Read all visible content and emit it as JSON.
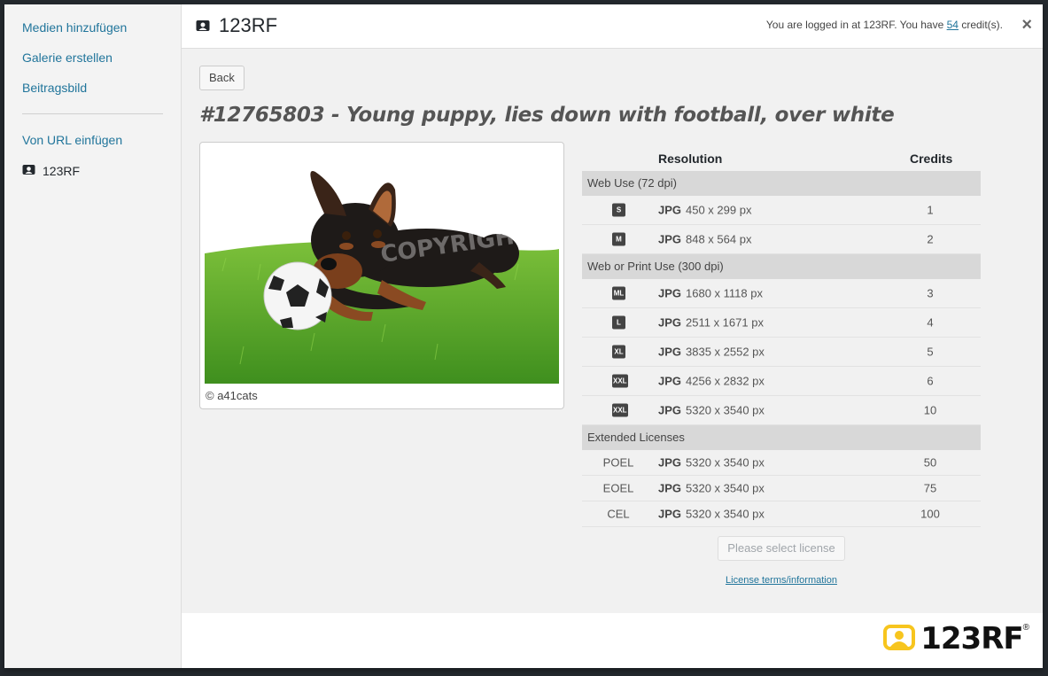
{
  "sidebar": {
    "items": [
      {
        "label": "Medien hinzufügen"
      },
      {
        "label": "Galerie erstellen"
      },
      {
        "label": "Beitragsbild"
      },
      {
        "label": "Von URL einfügen"
      },
      {
        "label": "123RF"
      }
    ]
  },
  "header": {
    "title": "123RF",
    "login_prefix": "You are logged in at 123RF. You have ",
    "credits": "54",
    "login_suffix": " credit(s).",
    "close_label": "×"
  },
  "main": {
    "back_label": "Back",
    "image_title": "#12765803 - Young puppy, lies down with football, over white",
    "image_credit": "© a41cats",
    "watermark": "COPYRIGHT"
  },
  "table": {
    "col_resolution": "Resolution",
    "col_credits": "Credits",
    "groups": [
      {
        "label": "Web Use (72 dpi)"
      },
      {
        "label": "Web or Print Use (300 dpi)"
      },
      {
        "label": "Extended Licenses"
      }
    ],
    "web": [
      {
        "size": "S",
        "format": "JPG",
        "resolution": "450 x 299 px",
        "credits": "1"
      },
      {
        "size": "M",
        "format": "JPG",
        "resolution": "848 x 564 px",
        "credits": "2"
      }
    ],
    "print": [
      {
        "size": "ML",
        "format": "JPG",
        "resolution": "1680 x 1118 px",
        "credits": "3"
      },
      {
        "size": "L",
        "format": "JPG",
        "resolution": "2511 x 1671 px",
        "credits": "4"
      },
      {
        "size": "XL",
        "format": "JPG",
        "resolution": "3835 x 2552 px",
        "credits": "5"
      },
      {
        "size": "XXL",
        "format": "JPG",
        "resolution": "4256 x 2832 px",
        "credits": "6"
      },
      {
        "size": "XXL",
        "format": "JPG",
        "resolution": "5320 x 3540 px",
        "credits": "10"
      }
    ],
    "extended": [
      {
        "code": "POEL",
        "format": "JPG",
        "resolution": "5320 x 3540 px",
        "credits": "50"
      },
      {
        "code": "EOEL",
        "format": "JPG",
        "resolution": "5320 x 3540 px",
        "credits": "75"
      },
      {
        "code": "CEL",
        "format": "JPG",
        "resolution": "5320 x 3540 px",
        "credits": "100"
      }
    ]
  },
  "actions": {
    "select_label": "Please select license",
    "terms_label": "License terms/information"
  },
  "footer": {
    "brand": "123RF",
    "reg_mark": "®"
  },
  "colors": {
    "link": "#21759b",
    "brand_yellow": "#f7c51e",
    "grass": "#5aa52a"
  }
}
